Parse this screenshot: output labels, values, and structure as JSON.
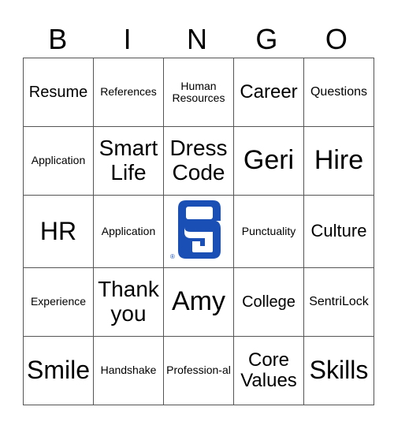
{
  "header": [
    "B",
    "I",
    "N",
    "G",
    "O"
  ],
  "rows": [
    [
      "Resume",
      "References",
      "Human Resources",
      "Career",
      "Questions"
    ],
    [
      "Application",
      "Smart Life",
      "Dress Code",
      "Geri",
      "Hire"
    ],
    [
      "HR",
      "Application",
      "",
      "Punctuality",
      "Culture"
    ],
    [
      "Experience",
      "Thank you",
      "Amy",
      "College",
      "SentriLock"
    ],
    [
      "Smile",
      "Handshake",
      "Profession-al",
      "Core Values",
      "Skills"
    ]
  ],
  "free_space": {
    "logo": "sentrilock-logo-icon",
    "mark": "®",
    "color": "#1a4fb5"
  }
}
